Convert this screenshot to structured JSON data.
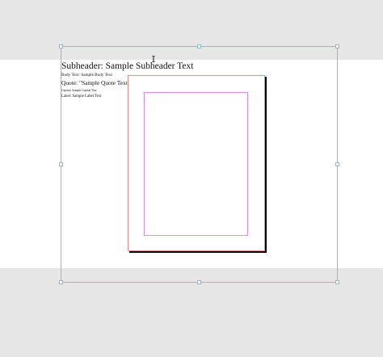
{
  "styles_sample": {
    "subheader": "Subheader: Sample Subheader Text",
    "body_text": "Body Text: Sample Body Text",
    "quote": "Quote: \"Sample Quote Text\"",
    "caption": "Caption: Sample Caption Text",
    "label": "Label: Sample Label Text"
  },
  "colors": {
    "pasteboard": "#e6e6e6",
    "canvas": "#ffffff",
    "selection": "#8db4e8",
    "bleed_guide": "#e48a8a",
    "margin_guide": "#e08ce0"
  },
  "icons": {
    "cursor": "text-cursor-icon"
  }
}
